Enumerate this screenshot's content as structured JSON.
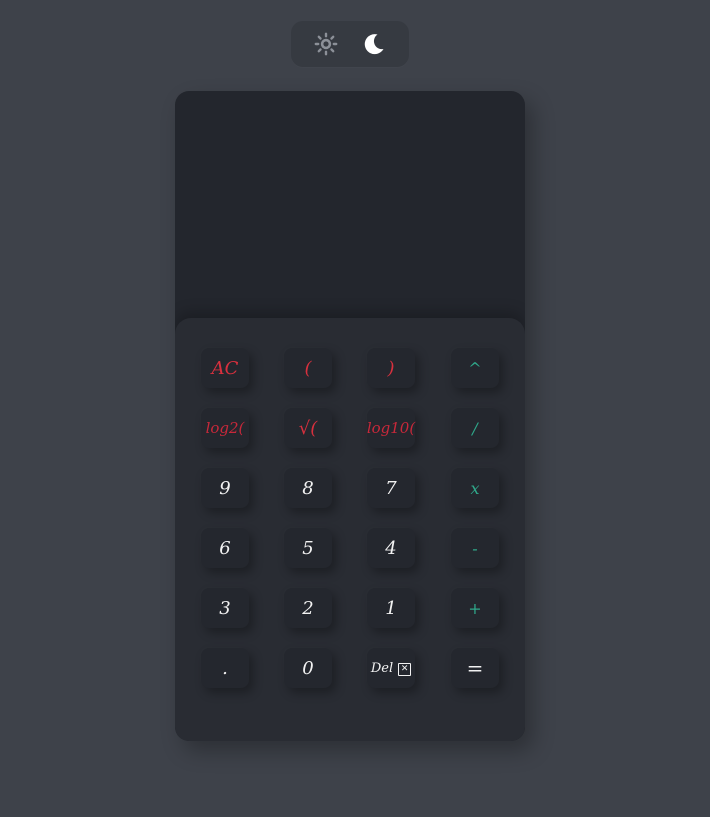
{
  "theme_switch": {
    "options": [
      {
        "name": "light",
        "icon": "sun-icon"
      },
      {
        "name": "dark",
        "icon": "moon-icon"
      }
    ],
    "active": "dark"
  },
  "display": {
    "expression": "",
    "result": ""
  },
  "keypad": {
    "rows": [
      [
        {
          "label": "AC",
          "style": "red"
        },
        {
          "label": "(",
          "style": "red"
        },
        {
          "label": ")",
          "style": "red"
        },
        {
          "label": "^",
          "style": "teal"
        }
      ],
      [
        {
          "label": "log2(",
          "style": "redfn"
        },
        {
          "label": "√(",
          "style": "red"
        },
        {
          "label": "log10(",
          "style": "redfn"
        },
        {
          "label": "/",
          "style": "teal"
        }
      ],
      [
        {
          "label": "9",
          "style": "num"
        },
        {
          "label": "8",
          "style": "num"
        },
        {
          "label": "7",
          "style": "num"
        },
        {
          "label": "x",
          "style": "teal"
        }
      ],
      [
        {
          "label": "6",
          "style": "num"
        },
        {
          "label": "5",
          "style": "num"
        },
        {
          "label": "4",
          "style": "num"
        },
        {
          "label": "-",
          "style": "teal"
        }
      ],
      [
        {
          "label": "3",
          "style": "num"
        },
        {
          "label": "2",
          "style": "num"
        },
        {
          "label": "1",
          "style": "num"
        },
        {
          "label": "+",
          "style": "teal"
        }
      ],
      [
        {
          "label": ".",
          "style": "num"
        },
        {
          "label": "0",
          "style": "num"
        },
        {
          "label": "Del",
          "style": "del"
        },
        {
          "label": "=",
          "style": "eq"
        }
      ]
    ]
  },
  "colors": {
    "background": "#3e424a",
    "calculator": "#23262d",
    "keypad": "#292c33",
    "key": "#24272e",
    "red_accent": "#d8303e",
    "teal_accent": "#2fa88a",
    "text": "#f2f2f2"
  }
}
